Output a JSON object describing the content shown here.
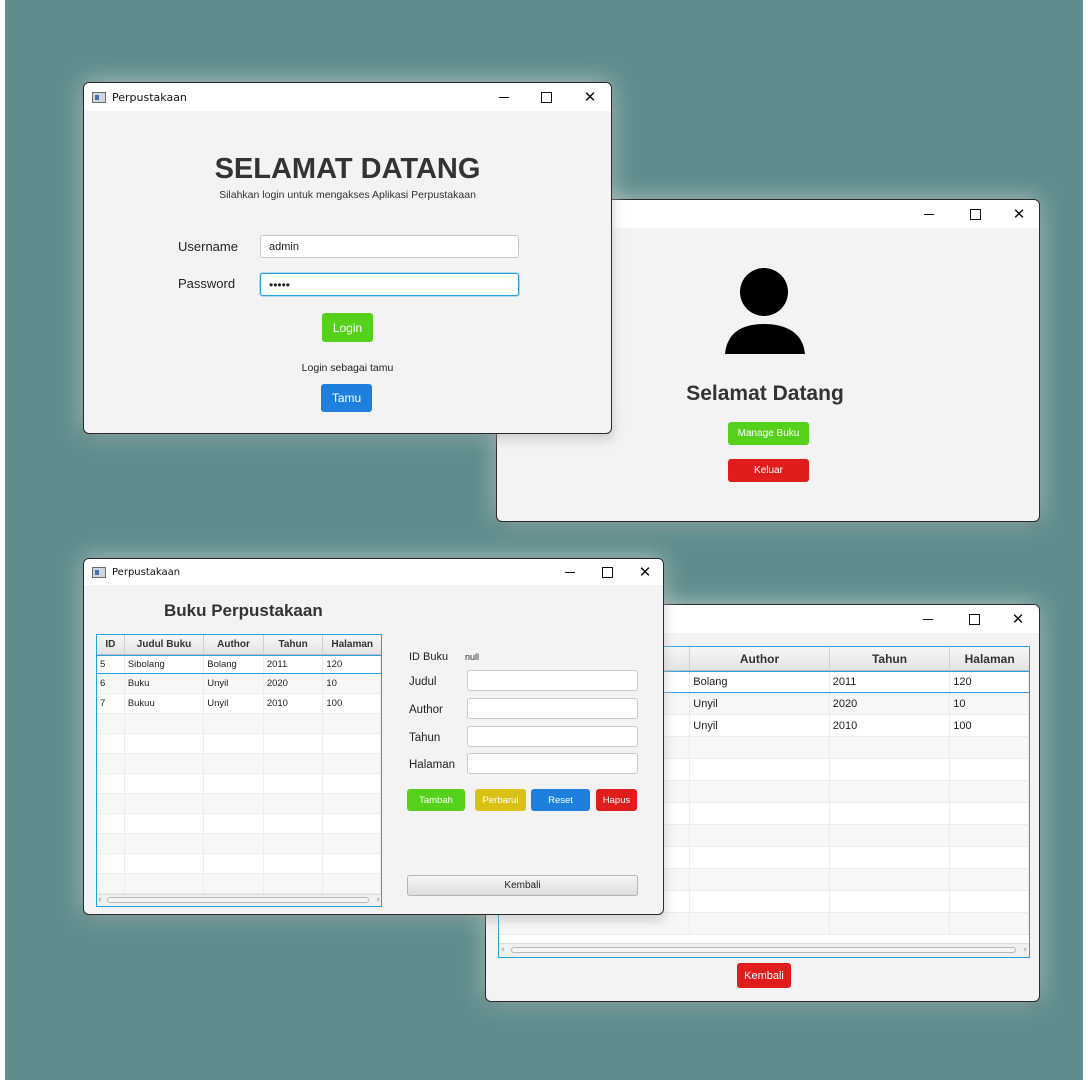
{
  "login_window": {
    "title": "Perpustakaan",
    "heading": "SELAMAT DATANG",
    "subtitle": "Silahkan login untuk mengakses Aplikasi Perpustakaan",
    "username_label": "Username",
    "username_value": "admin",
    "password_label": "Password",
    "password_value": "•••••",
    "login_button": "Login",
    "guest_text": "Login sebagai tamu",
    "guest_button": "Tamu"
  },
  "welcome_window": {
    "title": "",
    "heading": "Selamat Datang",
    "manage_button": "Manage Buku",
    "exit_button": "Keluar"
  },
  "admin_books_window": {
    "title": "Perpustakaan",
    "heading": "Buku Perpustakaan",
    "columns": [
      "ID",
      "Judul Buku",
      "Author",
      "Tahun",
      "Halaman"
    ],
    "rows": [
      [
        "5",
        "Sibolang",
        "Bolang",
        "2011",
        "120"
      ],
      [
        "6",
        "Buku",
        "Unyil",
        "2020",
        "10"
      ],
      [
        "7",
        "Bukuu",
        "Unyil",
        "2010",
        "100"
      ]
    ],
    "form": {
      "id_label": "ID Buku",
      "id_value": "null",
      "judul_label": "Judul",
      "author_label": "Author",
      "tahun_label": "Tahun",
      "halaman_label": "Halaman"
    },
    "buttons": {
      "tambah": "Tambah",
      "perbarui": "Perbarui",
      "reset": "Reset",
      "hapus": "Hapus",
      "kembali": "Kembali"
    }
  },
  "guest_books_window": {
    "title": "",
    "columns": [
      "Author",
      "Tahun",
      "Halaman"
    ],
    "rows": [
      [
        "Bolang",
        "2011",
        "120"
      ],
      [
        "Unyil",
        "2020",
        "10"
      ],
      [
        "Unyil",
        "2010",
        "100"
      ]
    ],
    "back_button": "Kembali"
  },
  "colors": {
    "backdrop": "#5f8d8d",
    "green": "#55d11c",
    "blue": "#1f7fdc",
    "red": "#df1d1d",
    "yellow": "#d9c116",
    "focus": "#2a9fe0"
  }
}
